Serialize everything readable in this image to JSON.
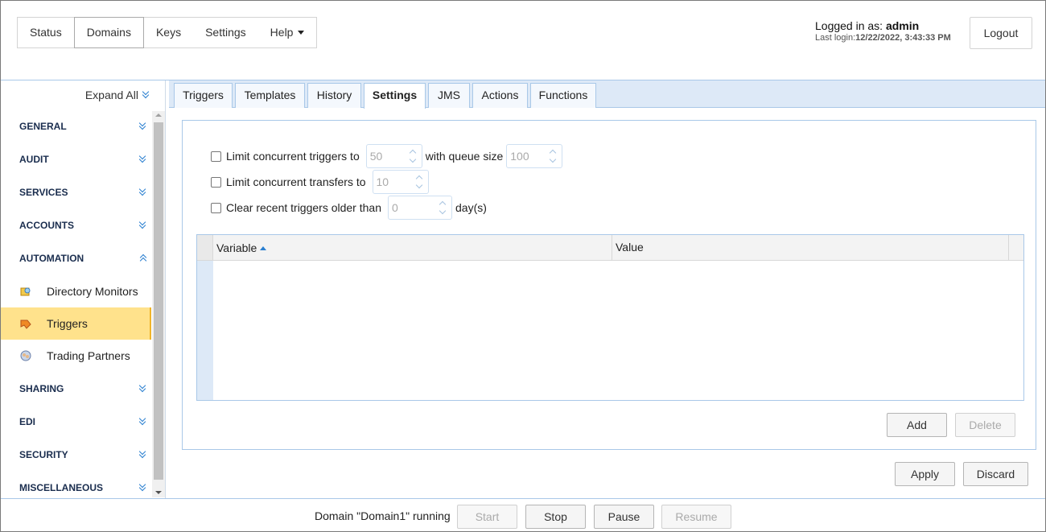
{
  "top_nav": {
    "items": [
      {
        "label": "Status"
      },
      {
        "label": "Domains"
      },
      {
        "label": "Keys"
      },
      {
        "label": "Settings"
      },
      {
        "label": "Help"
      }
    ]
  },
  "user": {
    "logged_in_prefix": "Logged in as: ",
    "username": "admin",
    "last_login_prefix": "Last login:",
    "last_login": "12/22/2022, 3:43:33 PM",
    "logout_label": "Logout"
  },
  "sidebar": {
    "expand_all": "Expand All",
    "sections": {
      "general": "GENERAL",
      "audit": "AUDIT",
      "services": "SERVICES",
      "accounts": "ACCOUNTS",
      "automation": "AUTOMATION",
      "sharing": "SHARING",
      "edi": "EDI",
      "security": "SECURITY",
      "miscellaneous": "MISCELLANEOUS"
    },
    "automation_items": [
      {
        "label": "Directory Monitors"
      },
      {
        "label": "Triggers"
      },
      {
        "label": "Trading Partners"
      }
    ]
  },
  "tabs": [
    {
      "label": "Triggers"
    },
    {
      "label": "Templates"
    },
    {
      "label": "History"
    },
    {
      "label": "Settings"
    },
    {
      "label": "JMS"
    },
    {
      "label": "Actions"
    },
    {
      "label": "Functions"
    }
  ],
  "settings": {
    "limit_triggers_label": "Limit concurrent triggers to",
    "limit_triggers_value": "50",
    "queue_size_label": "with queue size",
    "queue_size_value": "100",
    "limit_transfers_label": "Limit concurrent transfers to",
    "limit_transfers_value": "10",
    "clear_recent_label": "Clear recent triggers older than",
    "clear_recent_value": "0",
    "days_label": "day(s)"
  },
  "variables_table": {
    "columns": [
      "Variable",
      "Value"
    ],
    "rows": []
  },
  "buttons": {
    "add": "Add",
    "delete": "Delete",
    "apply": "Apply",
    "discard": "Discard"
  },
  "footer": {
    "status_text": "Domain \"Domain1\" running",
    "start": "Start",
    "stop": "Stop",
    "pause": "Pause",
    "resume": "Resume"
  },
  "colors": {
    "selected_item_bg": "#ffe28c",
    "tab_bar_bg": "#dde9f7",
    "accent_blue": "#2a7fd0"
  }
}
